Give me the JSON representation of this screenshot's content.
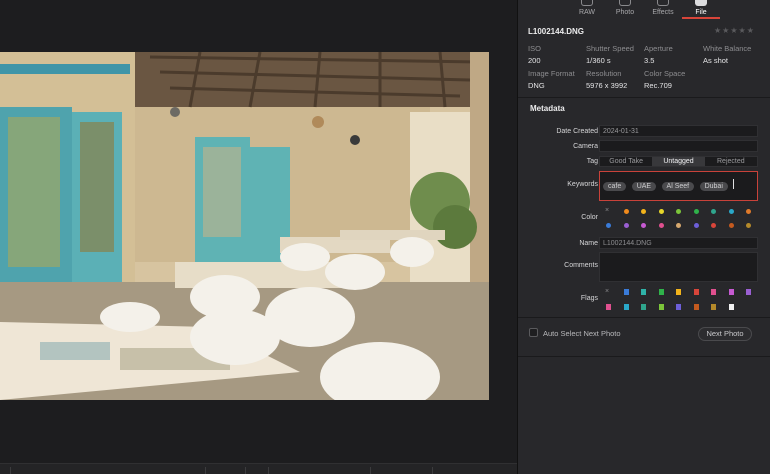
{
  "tabs": [
    {
      "label": "RAW",
      "icon": "raw-icon"
    },
    {
      "label": "Photo",
      "icon": "photo-icon"
    },
    {
      "label": "Effects",
      "icon": "effects-icon"
    },
    {
      "label": "File",
      "icon": "file-icon",
      "active": true
    }
  ],
  "file": {
    "name": "L1002144.DNG",
    "rating_stars": "★★★★★",
    "rating": 0
  },
  "info": {
    "iso_label": "ISO",
    "iso_value": "200",
    "shutter_label": "Shutter Speed",
    "shutter_value": "1/360 s",
    "aperture_label": "Aperture",
    "aperture_value": "3.5",
    "wb_label": "White Balance",
    "wb_value": "As shot",
    "format_label": "Image Format",
    "format_value": "DNG",
    "resolution_label": "Resolution",
    "resolution_value": "5976 x 3992",
    "colorspace_label": "Color Space",
    "colorspace_value": "Rec.709"
  },
  "metadata": {
    "title": "Metadata",
    "date_label": "Date Created",
    "date_value": "2024-01-31",
    "camera_label": "Camera",
    "camera_value": "",
    "tag_label": "Tag",
    "tag_options": [
      "Good Take",
      "Untagged",
      "Rejected"
    ],
    "tag_selected": "Untagged",
    "keywords_label": "Keywords",
    "keywords": [
      "cafe",
      "UAE",
      "Al Seef",
      "Dubai"
    ],
    "color_label": "Color",
    "color_none": "×",
    "colors_row1": [
      "#f08a1c",
      "#f2b31b",
      "#e6d62a",
      "#7cc53a",
      "#2fb24a",
      "#2fa58d",
      "#2aa8c9",
      "#e07a2a"
    ],
    "colors_row2": [
      "#3a7bd8",
      "#9a5fd2",
      "#c65ad2",
      "#e0508f",
      "#d7a86e",
      "#6d5fd8",
      "#d8453a",
      "#c45a1f",
      "#b58a2a"
    ],
    "name_label": "Name",
    "name_value": "L1002144.DNG",
    "comments_label": "Comments",
    "comments_value": "",
    "flags_label": "Flags",
    "flag_none": "×",
    "flags_row1": [
      "#3a7bd8",
      "#2fb2a8",
      "#2fb24a",
      "#f2b31b",
      "#d8453a",
      "#e0508f",
      "#c65ad2",
      "#9a5fd2"
    ],
    "flags_row2": [
      "#e0508f",
      "#2aa8c9",
      "#2fa58d",
      "#7cc53a",
      "#6d5fd8",
      "#c45a1f",
      "#b58a2a",
      "#f0f0f0"
    ]
  },
  "footer": {
    "auto_select_label": "Auto Select Next Photo",
    "auto_select_checked": false,
    "next_photo_label": "Next Photo"
  }
}
